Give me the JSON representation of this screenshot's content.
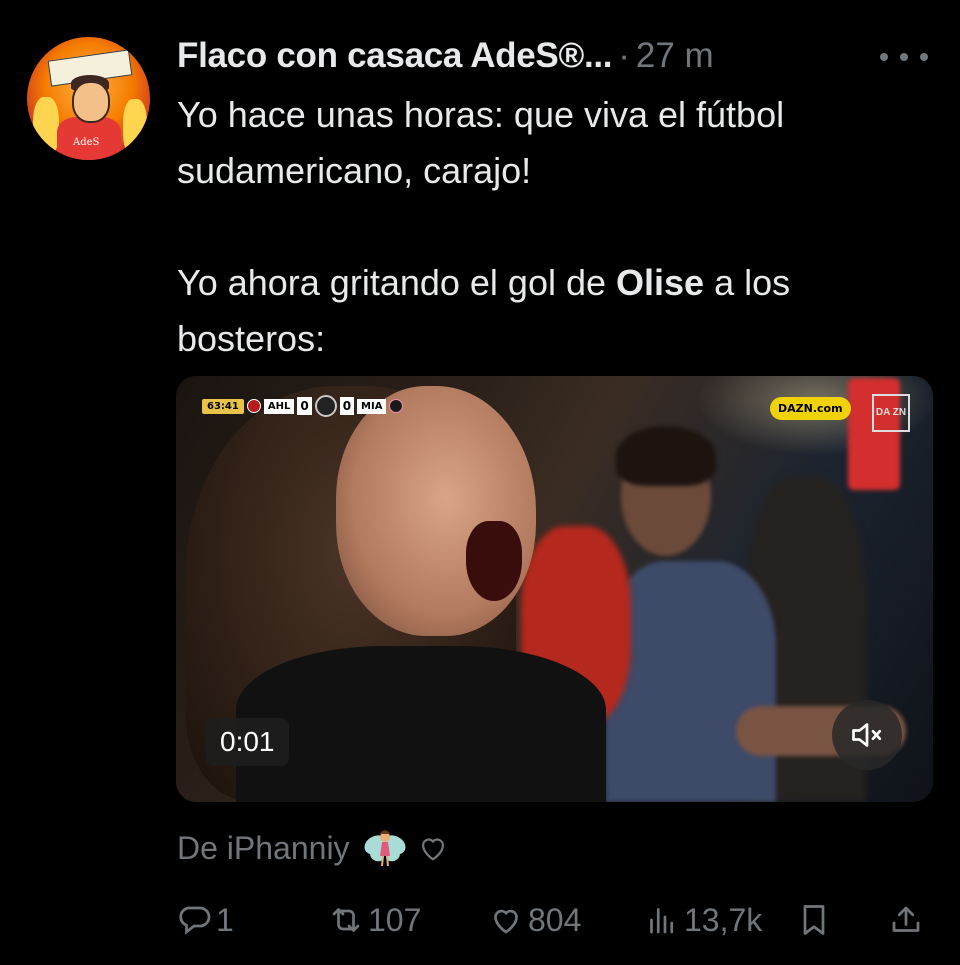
{
  "post": {
    "author_name": "Flaco con casaca AdeS®...",
    "separator": "·",
    "time_ago": "27 m",
    "paragraph1": "Yo hace unas horas: que viva el fútbol sudamericano, carajo!",
    "paragraph2_before": "Yo ahora gritando el gol de ",
    "paragraph2_bold": "Olise",
    "paragraph2_after": " a los bosteros:",
    "avatar_text": "AdeS",
    "source_text": "De iPhanniy",
    "icons": [
      "more-icon",
      "fairy-emoji",
      "heart-icon"
    ]
  },
  "video": {
    "duration_label": "0:01",
    "scorebug": {
      "clock": "63:41",
      "home": "AHL",
      "home_score": "0",
      "away_score": "0",
      "away": "MIA"
    },
    "sponsor": "DAZN.com",
    "network_logo": "DA ZN"
  },
  "actions": {
    "replies": "1",
    "reposts": "107",
    "likes": "804",
    "views": "13,7k"
  },
  "colors": {
    "background": "#000000",
    "text": "#e7e9ea",
    "muted": "#71767b"
  }
}
